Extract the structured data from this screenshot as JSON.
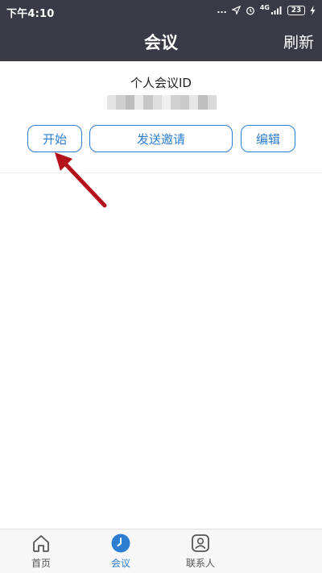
{
  "status_bar": {
    "time": "下午4:10",
    "more": "...",
    "network": "4G",
    "battery": "23"
  },
  "nav": {
    "title": "会议",
    "refresh_label": "刷新"
  },
  "meeting": {
    "id_label": "个人会议ID",
    "id_value_blurred": true,
    "buttons": {
      "start": "开始",
      "send_invite": "发送邀请",
      "edit": "编辑"
    }
  },
  "tabs": [
    {
      "label": "首页",
      "icon": "home-icon",
      "active": false
    },
    {
      "label": "会议",
      "icon": "clock-icon",
      "active": true
    },
    {
      "label": "联系人",
      "icon": "contacts-icon",
      "active": false
    }
  ],
  "colors": {
    "header_bg": "#3a3a46",
    "accent": "#2d7ed0",
    "annotation_arrow": "#b3141c"
  }
}
